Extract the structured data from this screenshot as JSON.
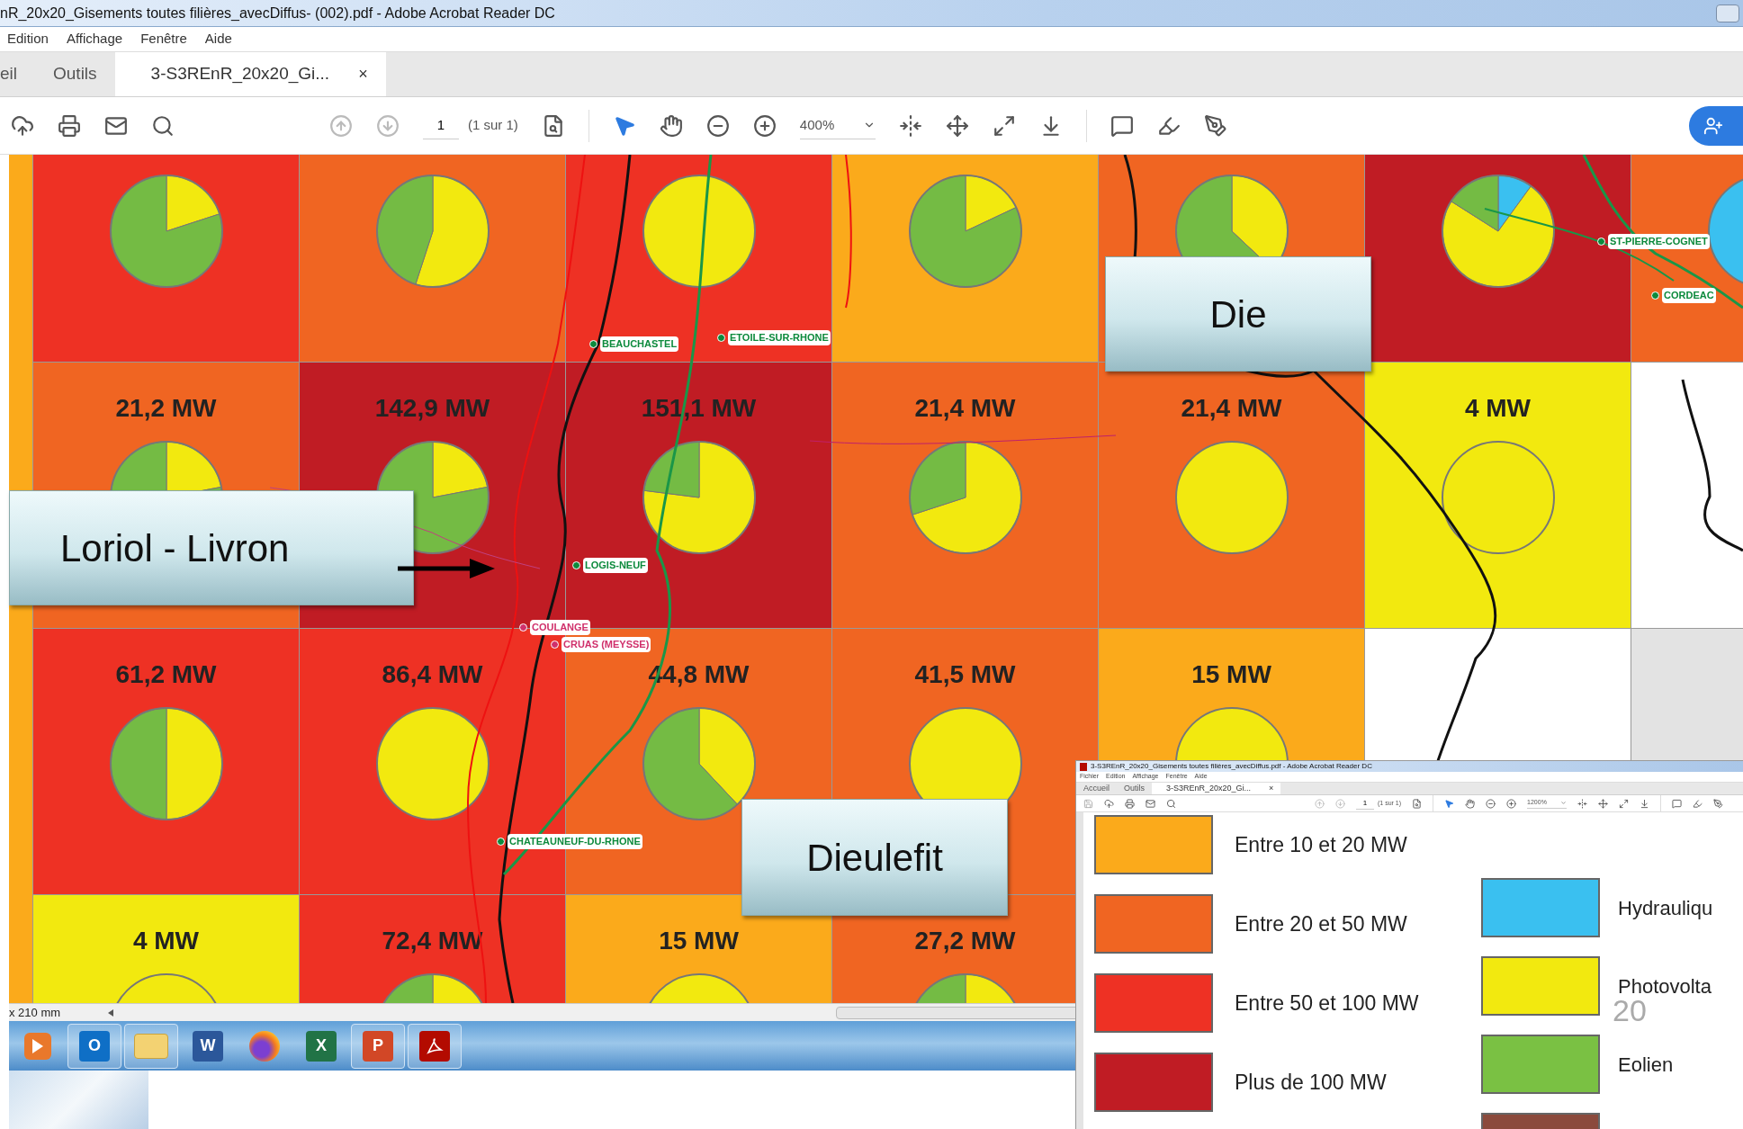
{
  "window": {
    "title": "nR_20x20_Gisements toutes filières_avecDiffus- (002).pdf - Adobe Acrobat Reader DC",
    "menu": [
      "Edition",
      "Affichage",
      "Fenêtre",
      "Aide"
    ],
    "tabs": [
      {
        "label": "eil",
        "selected": false
      },
      {
        "label": "Outils",
        "selected": false
      },
      {
        "label": "3-S3REnR_20x20_Gi...",
        "selected": true,
        "close": "×"
      }
    ],
    "toolbar": {
      "page": "1",
      "page_count": "(1 sur 1)",
      "zoom": "400%"
    }
  },
  "map": {
    "rows": [
      [
        {
          "color": "#ee3124"
        },
        {
          "color": "#f06522"
        },
        {
          "color": "#ee3124"
        },
        {
          "color": "#fbaa1b"
        },
        {
          "color": "#f06522"
        },
        {
          "color": "#c01c24"
        },
        {
          "color": "#f06522"
        }
      ],
      [
        {
          "color": "#f06522",
          "label": "21,2 MW"
        },
        {
          "color": "#c01c24",
          "label": "142,9 MW"
        },
        {
          "color": "#c01c24",
          "label": "151,1 MW"
        },
        {
          "color": "#f06522",
          "label": "21,4 MW"
        },
        {
          "color": "#f06522",
          "label": "21,4 MW"
        },
        {
          "color": "#f2e90f",
          "label": "4 MW"
        },
        {
          "color": "#ffffff"
        }
      ],
      [
        {
          "color": "#ee3124",
          "label": "61,2 MW"
        },
        {
          "color": "#ee3124",
          "label": "86,4 MW"
        },
        {
          "color": "#f06522",
          "label": "44,8 MW"
        },
        {
          "color": "#f06522",
          "label": "41,5 MW"
        },
        {
          "color": "#fbaa1b",
          "label": "15 MW"
        },
        {
          "color": "#ffffff"
        },
        {
          "color": "#e3e3e3"
        }
      ],
      [
        {
          "color": "#f2e90f",
          "label": "4 MW"
        },
        {
          "color": "#ee3124",
          "label": "72,4 MW"
        },
        {
          "color": "#fbaa1b",
          "label": "15 MW"
        },
        {
          "color": "#f06522",
          "label": "27,2 MW"
        }
      ]
    ],
    "places": [
      {
        "name": "BEAUCHASTEL",
        "kind": "station"
      },
      {
        "name": "ETOILE-SUR-RHONE",
        "kind": "station"
      },
      {
        "name": "LOGIS-NEUF",
        "kind": "station"
      },
      {
        "name": "COULANGE",
        "kind": "town"
      },
      {
        "name": "CRUAS (MEYSSE)",
        "kind": "town"
      },
      {
        "name": "CHATEAUNEUF-DU-RHONE",
        "kind": "station"
      },
      {
        "name": "ST-PIERRE-COGNET",
        "kind": "station"
      },
      {
        "name": "CORDEAC",
        "kind": "station"
      }
    ],
    "callouts": [
      "Die",
      "Loriol - Livron",
      "Dieulefit"
    ]
  },
  "status_bar": {
    "page_size": "x 210 mm"
  },
  "taskbar": {
    "items": [
      {
        "kind": "media",
        "open": false
      },
      {
        "kind": "mail",
        "open": true,
        "glyph": "O"
      },
      {
        "kind": "folder",
        "open": true
      },
      {
        "kind": "word",
        "open": false,
        "glyph": "W"
      },
      {
        "kind": "browser",
        "open": false
      },
      {
        "kind": "sheet",
        "open": false,
        "glyph": "X"
      },
      {
        "kind": "slides",
        "open": true,
        "glyph": "P"
      },
      {
        "kind": "pdf",
        "open": true
      }
    ]
  },
  "inset_window": {
    "title": "3-S3REnR_20x20_Gisements toutes filières_avecDiffus.pdf - Adobe Acrobat Reader DC",
    "menu": [
      "Fichier",
      "Edition",
      "Affichage",
      "Fenêtre",
      "Aide"
    ],
    "tabs": [
      {
        "label": "Accueil",
        "selected": false
      },
      {
        "label": "Outils",
        "selected": false
      },
      {
        "label": "3-S3REnR_20x20_Gi...",
        "selected": true,
        "close": "×"
      }
    ],
    "toolbar": {
      "page": "1",
      "page_count": "(1 sur 1)",
      "zoom": "1200%"
    },
    "legend_power": [
      {
        "color": "#fbaa1b",
        "label": "Entre 10 et 20 MW"
      },
      {
        "color": "#f06522",
        "label": "Entre 20 et 50 MW"
      },
      {
        "color": "#ee3124",
        "label": "Entre 50 et 100 MW"
      },
      {
        "color": "#c01c24",
        "label": "Plus de 100 MW"
      }
    ],
    "legend_source": [
      {
        "color": "#3ac0f0",
        "label": "Hydrauliqu"
      },
      {
        "color": "#f2e90f",
        "label": "Photovolta"
      },
      {
        "color": "#7ac143",
        "label": "Eolien"
      },
      {
        "color": "#8b4a3c"
      }
    ],
    "page_number": "20"
  }
}
